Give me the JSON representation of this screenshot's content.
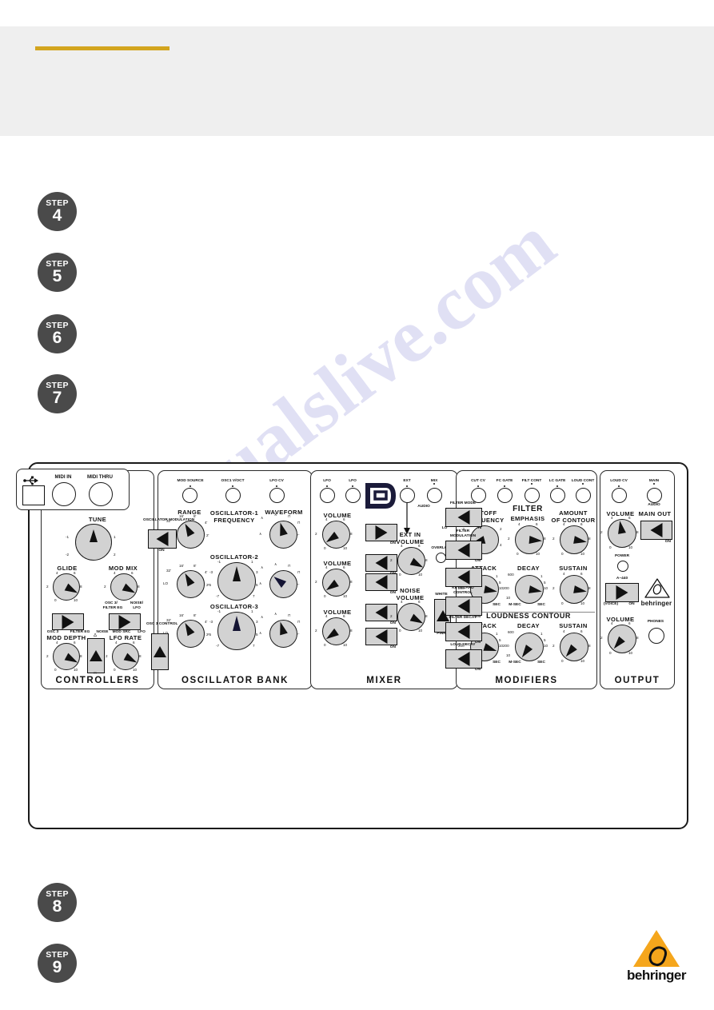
{
  "page": {
    "watermark": "manualslive.com",
    "accent_color": "#d3a51f",
    "header_band_color": "#efefef",
    "step_badge_color": "#4a4a4a"
  },
  "steps": [
    {
      "word": "STEP",
      "num": "4"
    },
    {
      "word": "STEP",
      "num": "5"
    },
    {
      "word": "STEP",
      "num": "6"
    },
    {
      "word": "STEP",
      "num": "7"
    },
    {
      "word": "STEP",
      "num": "8"
    },
    {
      "word": "STEP",
      "num": "9"
    }
  ],
  "synth": {
    "sections": {
      "controllers": {
        "title": "CONTROLLERS"
      },
      "oscillator_bank": {
        "title": "OSCILLATOR BANK"
      },
      "mixer": {
        "title": "MIXER"
      },
      "modifiers": {
        "title": "MODIFIERS"
      },
      "output": {
        "title": "OUTPUT"
      }
    },
    "jacks_row": {
      "usb": "usb-icon",
      "midi_in": "MIDI IN",
      "midi_thru": "MIDI THRU",
      "mod_source": "MOD SOURCE",
      "osc1_v_oct": "OSC1 V/OCT",
      "lfo_cv": "LFO CV",
      "lfo_a": "LFO",
      "lfo_tri": "LFO",
      "ext": "EXT",
      "mix": "MIX",
      "cut_cv": "CUT CV",
      "fc_gate": "FC GATE",
      "filt_cont": "FILT CONT",
      "lc_gate": "LC GATE",
      "loud_cont": "LOUD CONT",
      "loud_cv": "LOUD CV",
      "main": "MAIN",
      "audio_main": "AUDIO",
      "audio_ext": "AUDIO"
    },
    "controllers": {
      "tune": "TUNE",
      "glide": "GLIDE",
      "mod_mix": "MOD MIX",
      "mod_depth": "MOD DEPTH",
      "lfo_rate": "LFO RATE",
      "oscillator_modulation": "OSCILLATOR\nMODULATION",
      "osc_mod_on": "ON",
      "glide_sw_left": "OSC 3",
      "glide_sw_right": "FILTER EG",
      "modmix_upper_left": "OSC 3/",
      "modmix_upper_left2": "FILTER EG",
      "modmix_upper_right": "NOISE/",
      "modmix_upper_right2": "LFO",
      "modmix_sw_left": "NOISE",
      "modmix_sw_mid": "MOD SRC",
      "modmix_sw_right": "LFO",
      "lfo_wave_top": "△",
      "lfo_wave_bottom": "□"
    },
    "oscillator_bank": {
      "range": "RANGE",
      "osc1_frequency": "OSCILLATOR-1\nFREQUENCY",
      "waveform": "WAVEFORM",
      "oscillator_2": "OSCILLATOR-2",
      "oscillator_3": "OSCILLATOR-3",
      "osc3_control": "OSC 3\nCONTROL",
      "range_ticks": [
        "32'",
        "16'",
        "8'",
        "4'",
        "2'",
        "LO"
      ],
      "freq_ticks": [
        "-7",
        "-5",
        "-3",
        "-1",
        "1",
        "3",
        "5",
        "7"
      ]
    },
    "mixer": {
      "volume1": "VOLUME",
      "volume2": "VOLUME",
      "volume3": "VOLUME",
      "ext_in_volume": "EXT IN\nVOLUME",
      "noise_volume": "NOISE\nVOLUME",
      "overload": "OVERLOAD",
      "on_label": "ON",
      "noise_white": "WHITE",
      "noise_pink": "PINK"
    },
    "modifiers": {
      "cutoff_frequency": "CUTOFF\nFREQUENCY",
      "filter": "FILTER",
      "emphasis": "EMPHASIS",
      "amount_of_contour": "AMOUNT\nOF CONTOUR",
      "attack": "ATTACK",
      "decay": "DECAY",
      "sustain": "SUSTAIN",
      "loudness_contour": "LOUDNESS CONTOUR",
      "filter_mode": "FILTER MODE",
      "filter_mode_lo": "LO",
      "filter_mode_hi": "HI",
      "filter_modulation": "FILTER\nMODULATION",
      "keyboard_control": "KEYBOARD\nCONTROL",
      "filter_decay": "FILTER DECAY",
      "loud_decay": "LOUD DECAY",
      "on_label": "ON",
      "msec": "M-SEC",
      "sec": "SEC",
      "env_ticks": [
        "10",
        "200",
        "600",
        "1",
        "5",
        "10"
      ]
    },
    "output": {
      "volume_main": "VOLUME",
      "main_out": "MAIN OUT",
      "power": "POWER",
      "a440": "A~440",
      "voice": "(VOICE)",
      "on_label": "ON",
      "volume_phones": "VOLUME",
      "phones": "PHONES",
      "brand": "behringer"
    }
  },
  "brand": {
    "name": "behringer",
    "logo_color": "#f5a61c"
  }
}
